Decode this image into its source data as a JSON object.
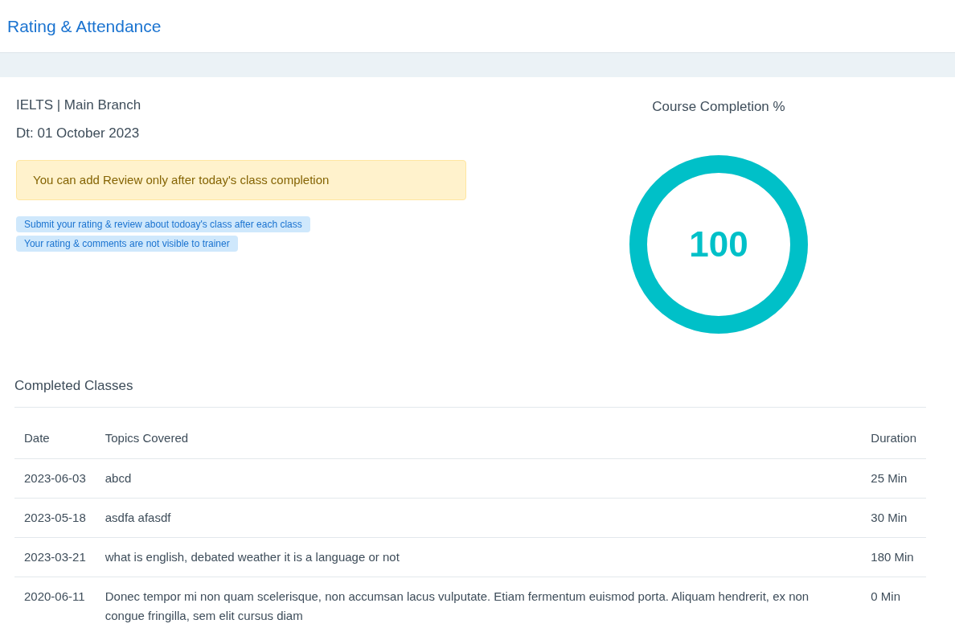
{
  "header": {
    "title": "Rating & Attendance"
  },
  "course": {
    "name": "IELTS | Main Branch",
    "date": "Dt: 01 October 2023",
    "alert": "You can add Review only after today's class completion",
    "notes": [
      "Submit your rating & review about todoay's class after each class",
      "Your rating & comments are not visible to trainer"
    ]
  },
  "completion": {
    "title": "Course Completion %",
    "value": "100",
    "level": 1
  },
  "completed_classes": {
    "title": "Completed Classes",
    "columns": [
      "Date",
      "Topics Covered",
      "Duration"
    ],
    "rows": [
      {
        "date": "2023-06-03",
        "topics": "abcd",
        "duration": "25 Min"
      },
      {
        "date": "2023-05-18",
        "topics": "asdfa afasdf",
        "duration": "30 Min"
      },
      {
        "date": "2023-03-21",
        "topics": "what is english, debated weather it is a language or not",
        "duration": "180 Min"
      },
      {
        "date": "2020-06-11",
        "topics": "Donec tempor mi non quam scelerisque, non accumsan lacus vulputate. Etiam fermentum euismod porta. Aliquam hendrerit, ex non congue fringilla, sem elit cursus diam",
        "duration": "0 Min"
      }
    ]
  }
}
